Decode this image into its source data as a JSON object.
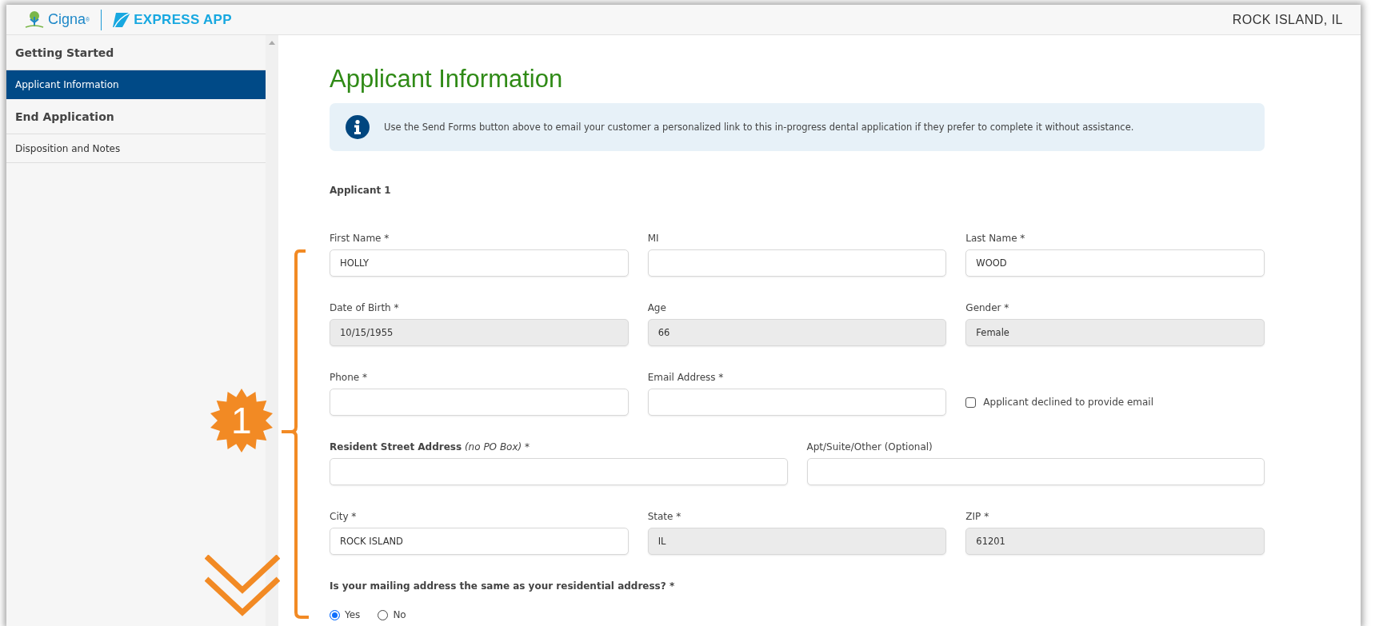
{
  "header": {
    "brand": "Cigna$^{®}$",
    "app_name": "EXPRESS APP",
    "location": "ROCK ISLAND, IL"
  },
  "sidebar": {
    "items": [
      {
        "label": "Getting Started",
        "kind": "section",
        "selected": false
      },
      {
        "label": "Applicant Information",
        "kind": "page",
        "selected": true
      },
      {
        "label": "End Application",
        "kind": "section",
        "selected": false
      },
      {
        "label": "Disposition and Notes",
        "kind": "page",
        "selected": false
      }
    ]
  },
  "page": {
    "title": "Applicant Information",
    "notice": "Use the Send Forms button above to email your customer a personalized link to this in-progress dental application if they prefer to complete it without assistance.",
    "section_title": "Applicant 1",
    "rows": [
      [
        {
          "kind": "text",
          "label": "First Name *",
          "value": "HOLLY",
          "disabled": false
        },
        {
          "kind": "text",
          "label": "MI",
          "disabled": false
        },
        {
          "kind": "text",
          "label": "Last Name *",
          "value": "WOOD",
          "disabled": false
        }
      ],
      [
        {
          "kind": "text",
          "label": "Date of Birth *",
          "value": "10/15/1955",
          "disabled": true
        },
        {
          "kind": "text",
          "label": "Age",
          "value": "66",
          "disabled": true
        },
        {
          "kind": "text",
          "label": "Gender *",
          "value": "Female",
          "disabled": true
        }
      ],
      [
        {
          "kind": "text",
          "label": "Phone *",
          "disabled": false
        },
        {
          "kind": "text",
          "label": "Email Address *",
          "disabled": false
        },
        {
          "kind": "checkbox",
          "label": "Applicant declined to provide email",
          "checked": false
        }
      ],
      [
        {
          "kind": "text",
          "label": "Resident Street Address",
          "note": "(no PO Box)",
          "mark": "*",
          "bold": true,
          "disabled": false
        },
        {
          "kind": "text",
          "label": "Apt/Suite/Other (Optional)",
          "disabled": false
        }
      ],
      [
        {
          "kind": "text",
          "label": "City *",
          "value": "ROCK ISLAND",
          "disabled": false
        },
        {
          "kind": "text",
          "label": "State *",
          "value": "IL",
          "disabled": true
        },
        {
          "kind": "text",
          "label": "ZIP *",
          "value": "61201",
          "disabled": true
        }
      ]
    ],
    "question": {
      "label": "Is your mailing address the same as your residential address? *",
      "options": [
        {
          "label": "Yes",
          "selected": true
        },
        {
          "label": "No",
          "selected": false
        }
      ]
    }
  },
  "annotation": {
    "step": "1"
  }
}
